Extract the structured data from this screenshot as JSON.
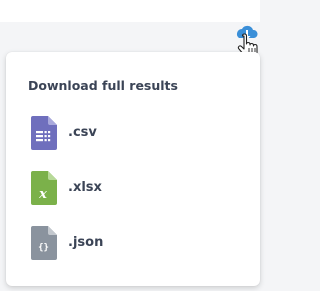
{
  "menu": {
    "title": "Download full results",
    "items": [
      {
        "label": ".csv",
        "icon": "csv-file-icon",
        "color": "#6f6fbd"
      },
      {
        "label": ".xlsx",
        "icon": "xlsx-file-icon",
        "color": "#7bb14a"
      },
      {
        "label": ".json",
        "icon": "json-file-icon",
        "color": "#8a939e"
      }
    ]
  },
  "trigger": {
    "icon": "cloud-download-icon",
    "color": "#3a8fd8"
  },
  "cursor": {
    "icon": "hand-pointer-icon"
  }
}
